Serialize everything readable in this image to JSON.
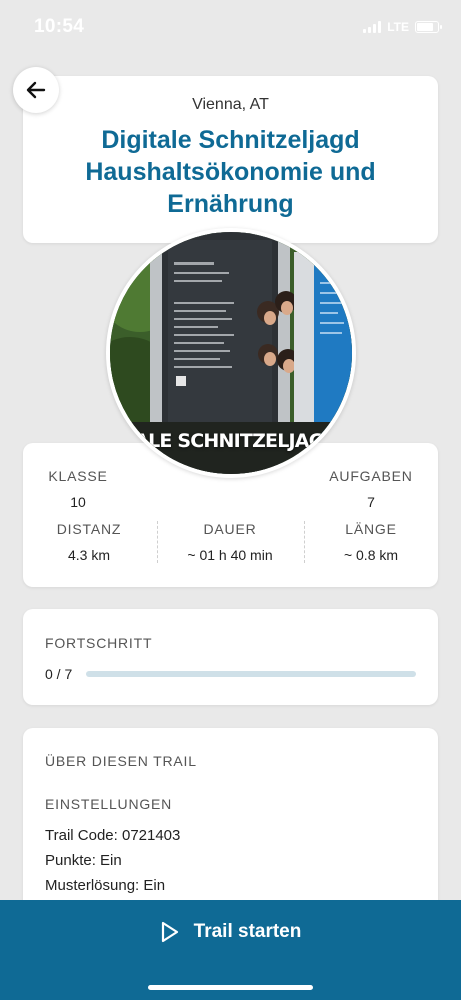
{
  "status_bar": {
    "time": "10:54",
    "network": "LTE",
    "icons": [
      "signal-icon",
      "battery-icon"
    ]
  },
  "header": {
    "back_icon": "arrow-left-icon",
    "location": "Vienna, AT",
    "title": "Digitale Schnitzeljagd Haushaltsökonomie und Ernährung"
  },
  "photo": {
    "overlay_text": "TALE SCHNITZELJAGD"
  },
  "stats": {
    "klasse": {
      "label": "KLASSE",
      "value": "10"
    },
    "aufgaben": {
      "label": "AUFGABEN",
      "value": "7"
    },
    "distanz": {
      "label": "DISTANZ",
      "value": "4.3 km"
    },
    "dauer": {
      "label": "DAUER",
      "value": "~ 01 h 40 min"
    },
    "laenge": {
      "label": "LÄNGE",
      "value": "~ 0.8 km"
    }
  },
  "progress": {
    "label": "FORTSCHRITT",
    "count": "0 / 7",
    "fraction": 0
  },
  "about": {
    "heading": "ÜBER DIESEN TRAIL",
    "settings_heading": "EINSTELLUNGEN",
    "trail_code": "Trail Code: 0721403",
    "punkte": "Punkte: Ein",
    "musterloesung": "Musterlösung: Ein"
  },
  "cta": {
    "label": "Trail starten",
    "icon": "play-icon"
  },
  "colors": {
    "accent": "#0f6a95",
    "background": "#e9e9e9",
    "progress_track": "#cfe0e8"
  }
}
